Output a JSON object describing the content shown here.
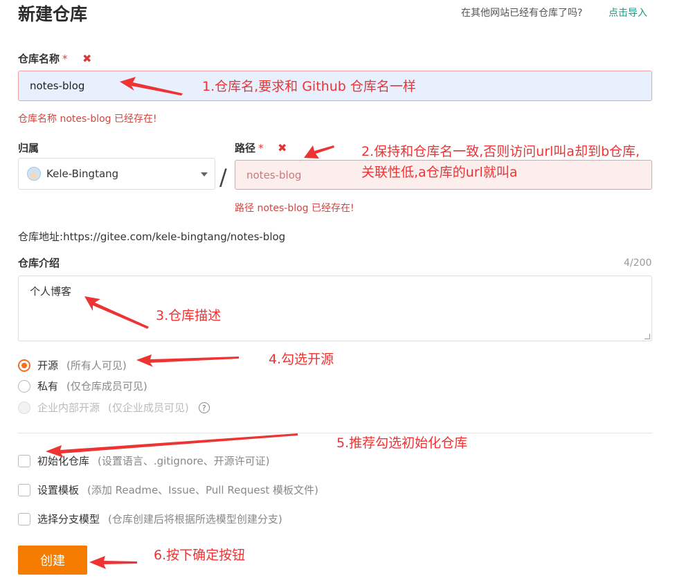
{
  "header": {
    "title": "新建仓库",
    "import_hint": "在其他网站已经有仓库了吗?",
    "import_link": "点击导入"
  },
  "name_field": {
    "label": "仓库名称",
    "required_mark": "*",
    "value": "notes-blog",
    "error": "仓库名称 notes-blog 已经存在!"
  },
  "owner_field": {
    "label": "归属",
    "value": "Kele-Bingtang"
  },
  "path_field": {
    "label": "路径",
    "required_mark": "*",
    "value": "notes-blog",
    "error": "路径 notes-blog 已经存在!"
  },
  "separator": "/",
  "repo_url": {
    "label": "仓库地址:",
    "value": "https://gitee.com/kele-bingtang/notes-blog"
  },
  "description_field": {
    "label": "仓库介绍",
    "counter": "4/200",
    "value": "个人博客"
  },
  "visibility": {
    "options": [
      {
        "label": "开源",
        "hint": "(所有人可见)",
        "checked": true,
        "disabled": false
      },
      {
        "label": "私有",
        "hint": "(仅仓库成员可见)",
        "checked": false,
        "disabled": false
      },
      {
        "label": "企业内部开源",
        "hint": "(仅企业成员可见)",
        "checked": false,
        "disabled": true
      }
    ],
    "help_glyph": "?"
  },
  "options": [
    {
      "label": "初始化仓库",
      "hint": "(设置语言、.gitignore、开源许可证)",
      "checked": false
    },
    {
      "label": "设置模板",
      "hint": "(添加 Readme、Issue、Pull Request 模板文件)",
      "checked": false
    },
    {
      "label": "选择分支模型",
      "hint": "(仓库创建后将根据所选模型创建分支)",
      "checked": false
    }
  ],
  "submit": {
    "label": "创建"
  },
  "annotations": [
    "1.仓库名,要求和 Github 仓库名一样",
    "2.保持和仓库名一致,否则访问url叫a却到b仓库,",
    "关联性低,a仓库的url就叫a",
    "3.仓库描述",
    "4.勾选开源",
    "5.推荐勾选初始化仓库",
    "6.按下确定按钮"
  ],
  "colors": {
    "accent": "#f36f21",
    "button": "#f57c00",
    "error": "#d0463f",
    "annotation": "#ee3333",
    "link": "#0f9d8a"
  }
}
